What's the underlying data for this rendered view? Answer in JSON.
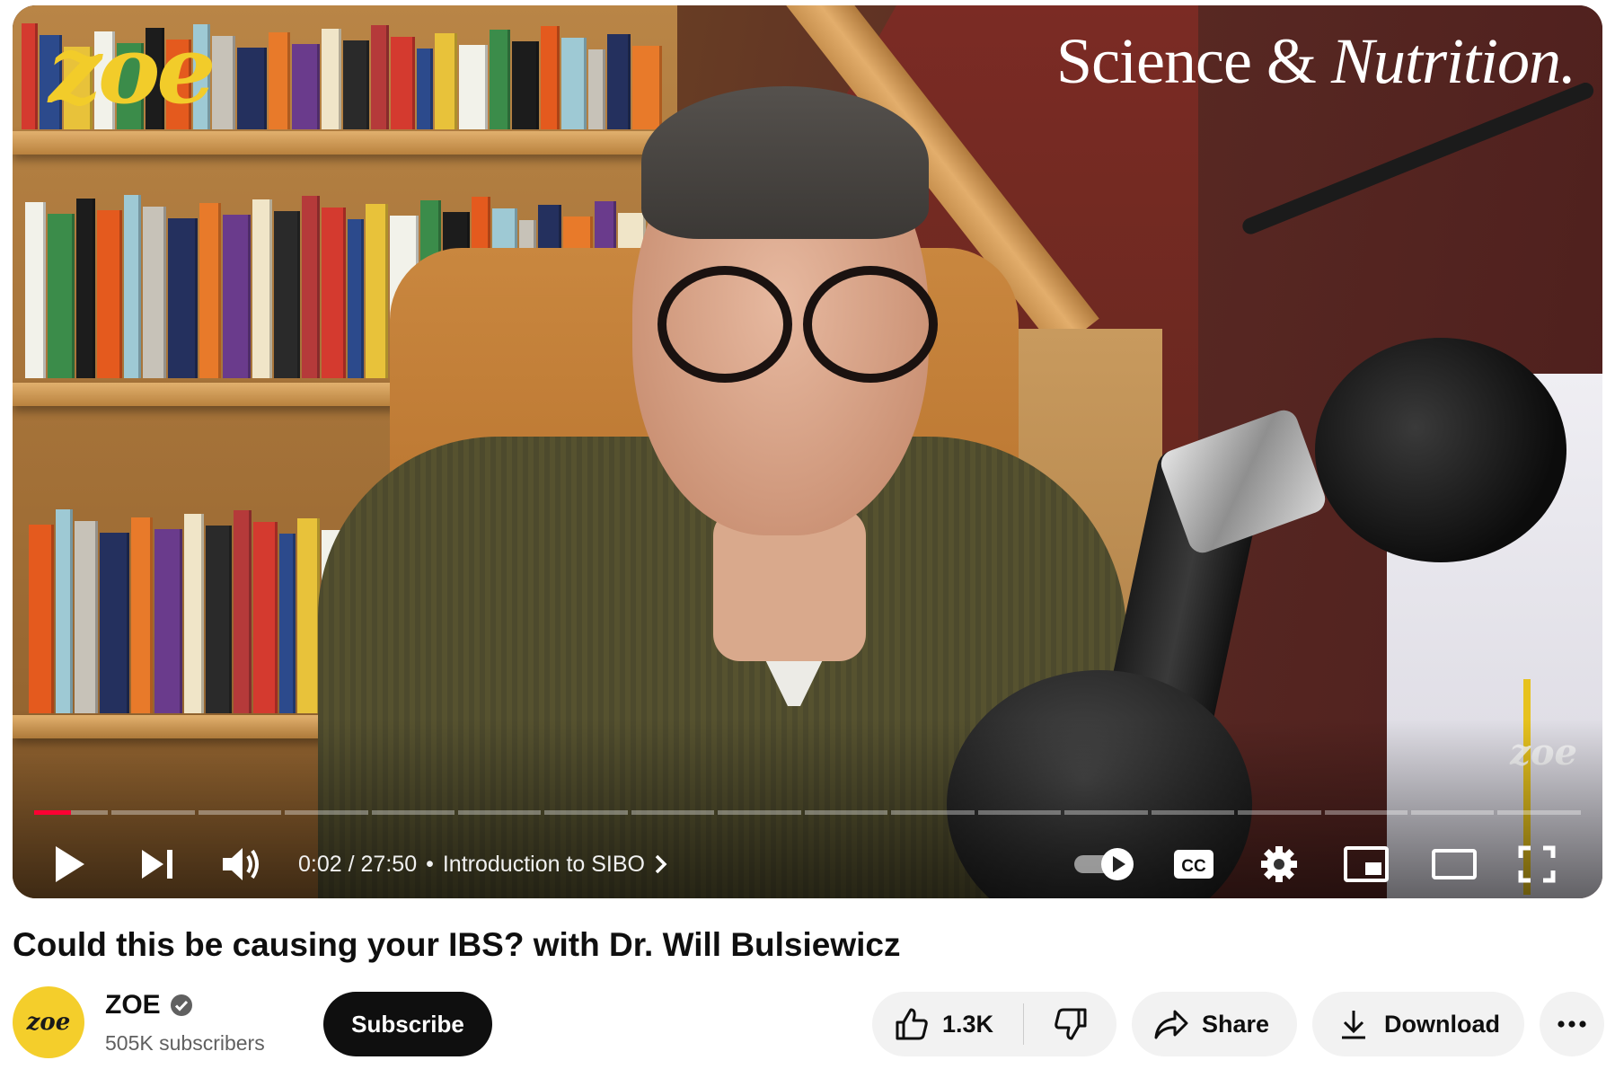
{
  "video": {
    "brand_logo": "zoe",
    "series_title_part1": "Science & ",
    "series_title_part2": "Nutrition.",
    "watermark": "zoe",
    "time_current": "0:02",
    "time_total": "27:50",
    "time_separator": "/",
    "chapter": "Introduction to SIBO",
    "progress_fraction": 0.0012,
    "accent_color": "#ff0033"
  },
  "title": "Could this be causing your IBS? with Dr. Will Bulsiewicz",
  "channel": {
    "avatar_text": "zoe",
    "name": "ZOE",
    "verified": true,
    "subscribers": "505K subscribers",
    "subscribe_label": "Subscribe"
  },
  "actions": {
    "likes": "1.3K",
    "share_label": "Share",
    "download_label": "Download",
    "more_label": "···"
  },
  "icons": [
    "play-icon",
    "next-icon",
    "volume-icon",
    "chevron-right-icon",
    "autoplay-toggle-icon",
    "cc-icon",
    "settings-icon",
    "miniplayer-icon",
    "theater-icon",
    "fullscreen-icon",
    "verified-icon",
    "thumbs-up-icon",
    "thumbs-down-icon",
    "share-icon",
    "download-icon",
    "more-icon"
  ]
}
